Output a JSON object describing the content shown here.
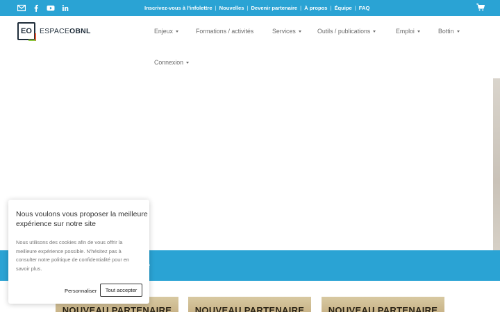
{
  "topbar": {
    "links": [
      "Inscrivez-vous à l'infolettre",
      "Nouvelles",
      "Devenir partenaire",
      "À propos",
      "Équipe",
      "FAQ"
    ],
    "separator": "|",
    "social": [
      "mail-icon",
      "facebook-icon",
      "youtube-icon",
      "linkedin-icon"
    ],
    "cart_icon": "cart-icon",
    "color": "#2aa3d4"
  },
  "header": {
    "logo": {
      "mark": "EO",
      "text_light": "ESPACE",
      "text_bold": "OBNL"
    },
    "nav": [
      {
        "label": "Enjeux",
        "dropdown": true
      },
      {
        "label": "Formations / activités",
        "dropdown": false
      },
      {
        "label": "Services",
        "dropdown": true
      },
      {
        "label": "Outils / publications",
        "dropdown": true
      },
      {
        "label": "Emploi",
        "dropdown": true
      },
      {
        "label": "Bottin",
        "dropdown": true
      },
      {
        "label": "Connexion",
        "dropdown": true
      }
    ]
  },
  "band": {
    "title": "e",
    "color": "#2aa3d4"
  },
  "cards": [
    {
      "label": "NOUVEAU PARTENAIRE"
    },
    {
      "label": "NOUVEAU PARTENAIRE"
    },
    {
      "label": "NOUVEAU PARTENAIRE"
    }
  ],
  "cookie": {
    "title": "Nous voulons vous proposer la meilleure expérience sur notre site",
    "body": "Nous utilisons des cookies afin de vous offrir la meilleure expérience possible. N'hésitez pas à consulter notre politique de confidentialité pour en savoir plus.",
    "customize_label": "Personnaliser",
    "accept_label": "Tout accepter"
  }
}
